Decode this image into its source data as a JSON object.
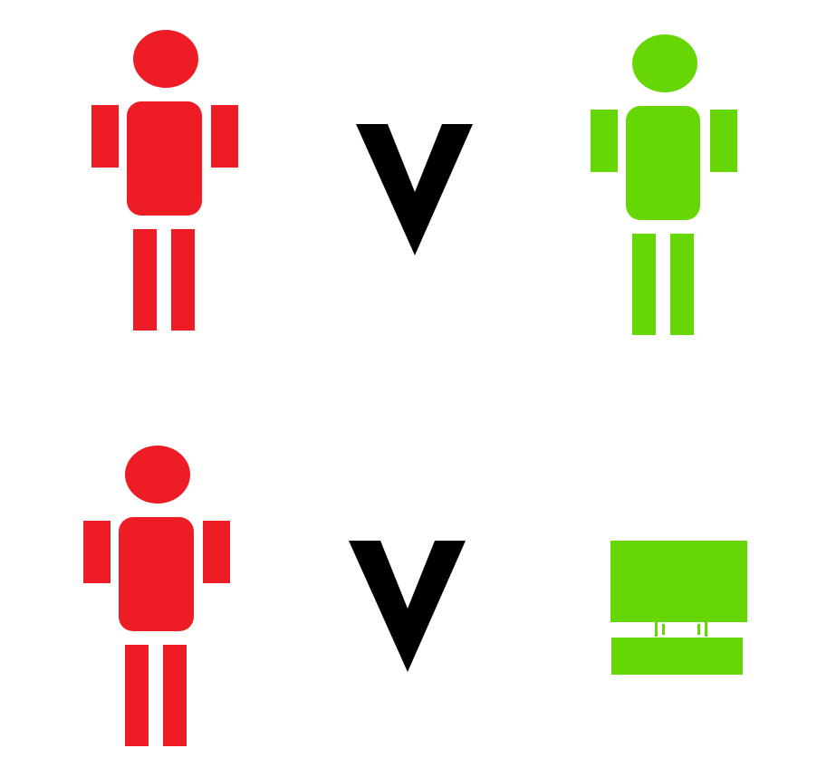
{
  "colors": {
    "background": "#ffffff",
    "player_one": "#ee1d25",
    "player_two": "#66d605",
    "versus_mark": "#000000"
  },
  "matchups": [
    {
      "left_icon": "red-person-icon",
      "versus_icon": "versus-v-icon",
      "right_icon": "green-person-icon"
    },
    {
      "left_icon": "red-person-icon",
      "versus_icon": "versus-v-icon",
      "right_icon": "green-computer-icon"
    }
  ]
}
